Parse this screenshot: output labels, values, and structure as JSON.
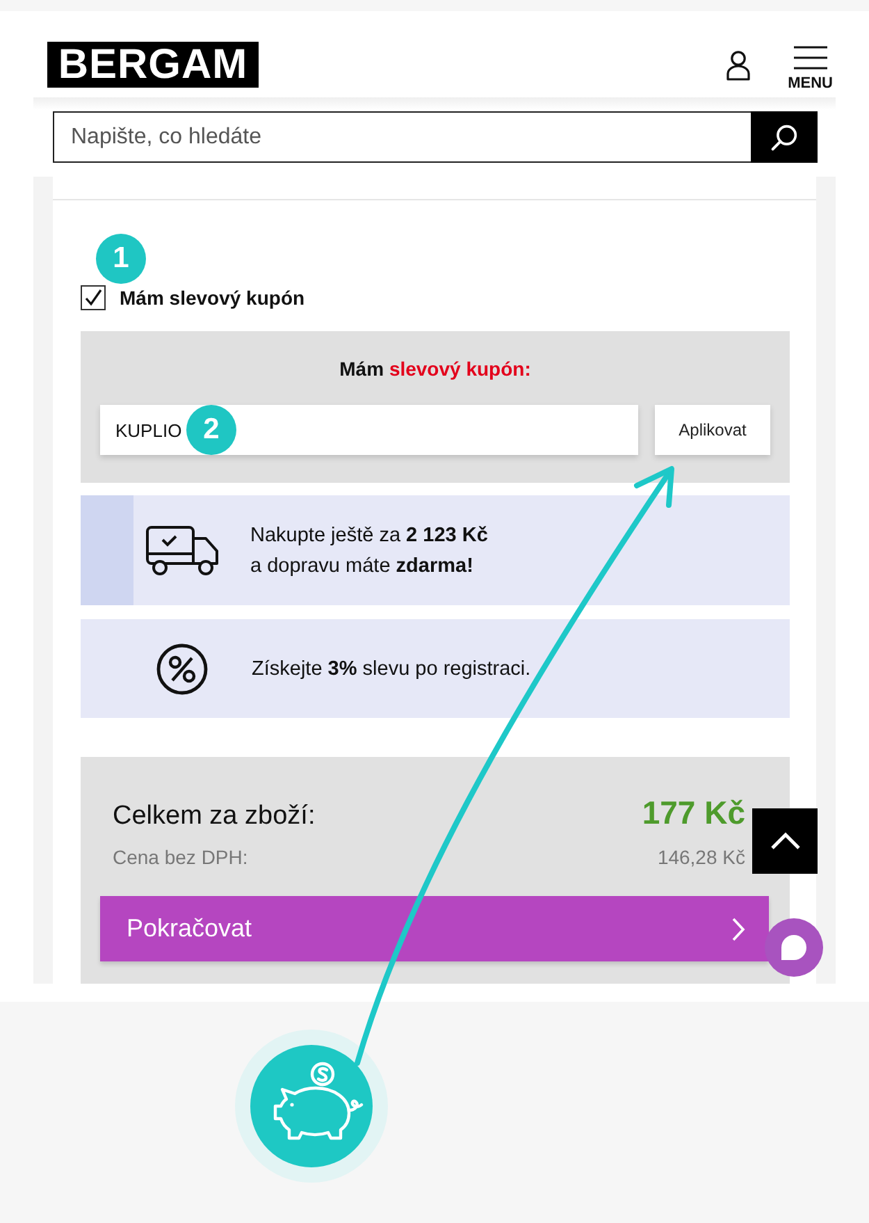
{
  "header": {
    "logo": "BERGAM",
    "menu_label": "MENU"
  },
  "search": {
    "placeholder": "Napište, co hledáte"
  },
  "coupon_checkbox": {
    "label": "Mám slevový kupón",
    "checked": true
  },
  "coupon_panel": {
    "heading": "Mám",
    "heading_highlight": "slevový kupón:",
    "code": "KUPLIO",
    "apply_button": "Aplikovat"
  },
  "banners": [
    {
      "kind": "shipping",
      "lines": [
        "Nakupte ještě za **2 123 Kč**",
        "a dopravu máte **zdarma!**"
      ]
    },
    {
      "kind": "discount",
      "lines": [
        "Získejte **3%** slevu po registraci."
      ]
    }
  ],
  "summary": {
    "total_label": "Celkem za zboží:",
    "total": "177 Kč",
    "net_label": "Cena bez DPH:",
    "net": "146,28 Kč",
    "continue_button": "Pokračovat"
  },
  "annotations": [
    {
      "label": "1"
    },
    {
      "label": "2"
    }
  ]
}
